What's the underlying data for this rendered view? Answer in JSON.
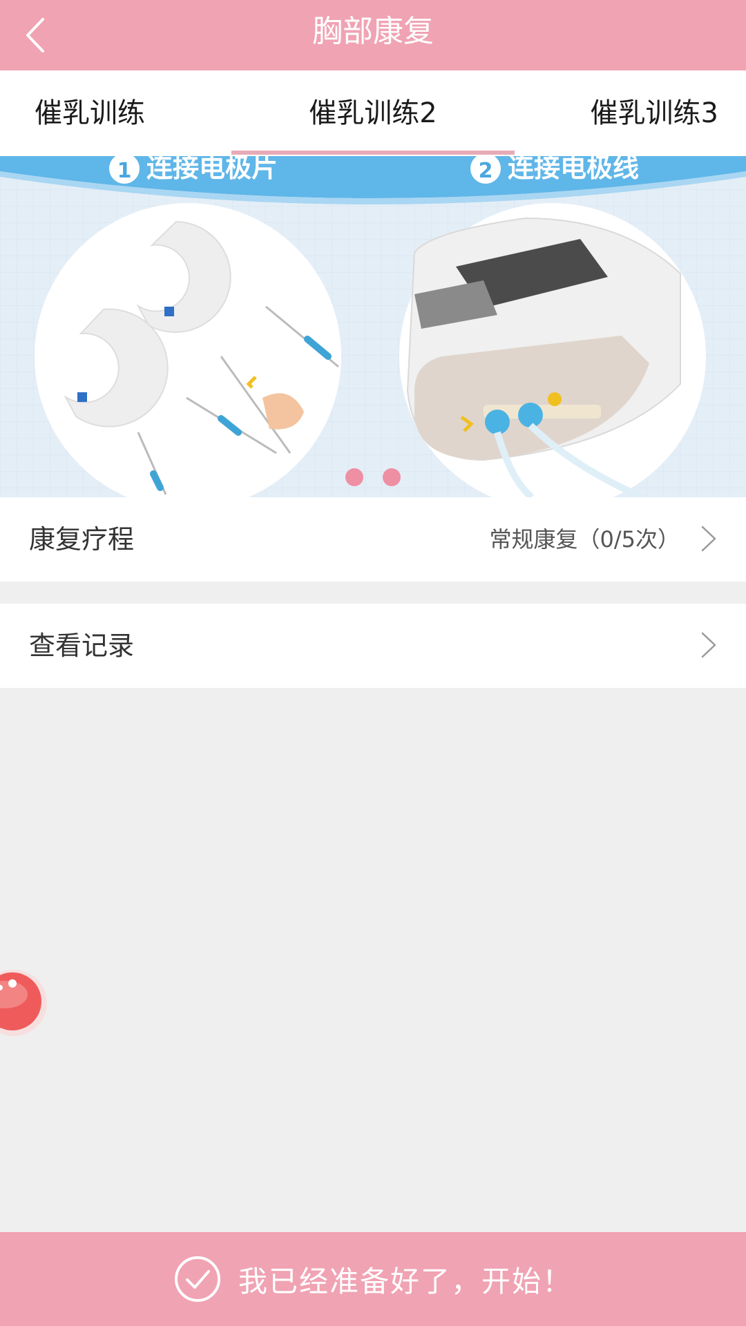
{
  "header": {
    "title": "胸部康复",
    "back_icon": "chevron-left-icon"
  },
  "tabs": [
    {
      "label": "催乳训练"
    },
    {
      "label": "催乳训练2",
      "active": true
    },
    {
      "label": "催乳训练3"
    }
  ],
  "banner": {
    "step1": "1",
    "step1_label": "连接电极片",
    "step2": "2",
    "step2_label": "连接电极线",
    "slide_count": 2,
    "active_slide": 1
  },
  "rows": [
    {
      "label": "康复疗程",
      "value": "常规康复（0/5次）"
    },
    {
      "label": "查看记录",
      "value": ""
    }
  ],
  "footer": {
    "button_label": "我已经准备好了，开始！",
    "icon": "check-circle-icon"
  },
  "colors": {
    "accent": "#f0a3b3",
    "tab_indicator": "#e7aab7",
    "dot": "#ee8fa4",
    "background": "#efefef"
  }
}
